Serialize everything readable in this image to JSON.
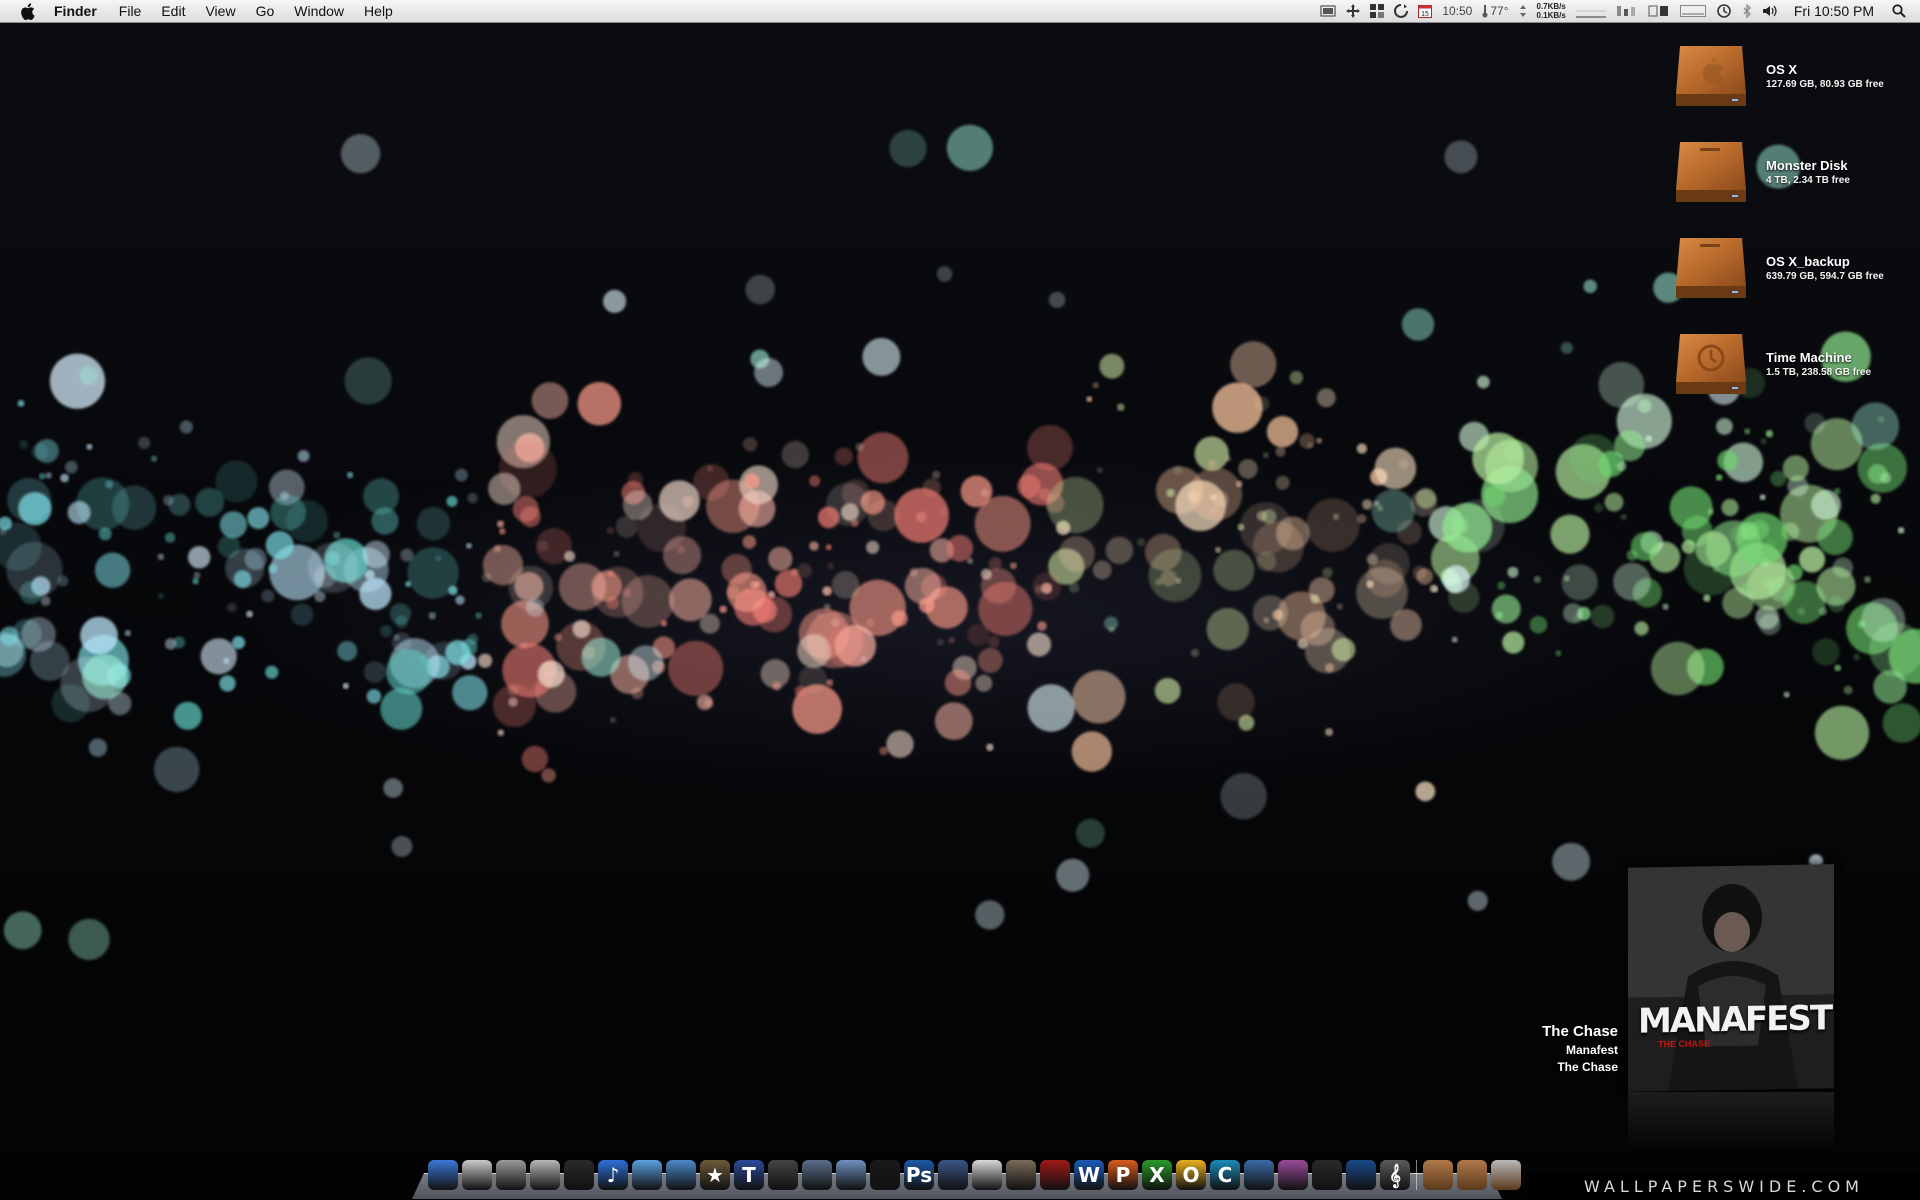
{
  "menubar": {
    "app_name": "Finder",
    "menus": [
      "File",
      "Edit",
      "View",
      "Go",
      "Window",
      "Help"
    ],
    "status": {
      "cal_day": "15",
      "time_short": "10:50",
      "temperature": "77°",
      "net_up": "0.7KB/s",
      "net_down": "0.1KB/s",
      "clock": "Fri 10:50 PM"
    }
  },
  "disks": [
    {
      "name": "OS X",
      "info": "127.69 GB, 80.93 GB free",
      "icon": "apple-logo"
    },
    {
      "name": "Monster Disk",
      "info": "4 TB, 2.34 TB free",
      "icon": "plain"
    },
    {
      "name": "OS X_backup",
      "info": "639.79 GB, 594.7 GB free",
      "icon": "plain"
    },
    {
      "name": "Time Machine",
      "info": "1.5 TB, 238.58 GB free",
      "icon": "time-machine"
    }
  ],
  "now_playing": {
    "title": "The Chase",
    "artist": "Manafest",
    "album": "The Chase",
    "cover_band": "MANAFEST",
    "cover_sub": "THE CHASE"
  },
  "dock": {
    "items": [
      {
        "name": "finder",
        "color": "#3a78d8",
        "glyph": ""
      },
      {
        "name": "preview",
        "color": "#c9c9c9",
        "glyph": ""
      },
      {
        "name": "system-preferences",
        "color": "#9a9a9a",
        "glyph": ""
      },
      {
        "name": "disk-utility",
        "color": "#b8b8b8",
        "glyph": ""
      },
      {
        "name": "activity-monitor",
        "color": "#2a2a2a",
        "glyph": ""
      },
      {
        "name": "itunes",
        "color": "#2f6fd8",
        "glyph": "♪"
      },
      {
        "name": "safari",
        "color": "#5aa0e0",
        "glyph": ""
      },
      {
        "name": "mail",
        "color": "#4a88c8",
        "glyph": ""
      },
      {
        "name": "imovie",
        "color": "#6b5a3a",
        "glyph": "★"
      },
      {
        "name": "textedit",
        "color": "#2c4a9a",
        "glyph": "T"
      },
      {
        "name": "final-cut",
        "color": "#444",
        "glyph": ""
      },
      {
        "name": "iphoto",
        "color": "#5a6e8a",
        "glyph": ""
      },
      {
        "name": "xcode",
        "color": "#6f8fc0",
        "glyph": ""
      },
      {
        "name": "aperture",
        "color": "#1a1a1a",
        "glyph": ""
      },
      {
        "name": "photoshop",
        "color": "#1d5aa8",
        "glyph": "Ps"
      },
      {
        "name": "illustrator",
        "color": "#3a5588",
        "glyph": ""
      },
      {
        "name": "pages",
        "color": "#d8d8d8",
        "glyph": ""
      },
      {
        "name": "iphoto-library",
        "color": "#7a6a5a",
        "glyph": ""
      },
      {
        "name": "photo-booth",
        "color": "#a01818",
        "glyph": ""
      },
      {
        "name": "word",
        "color": "#1a5ab8",
        "glyph": "W"
      },
      {
        "name": "powerpoint",
        "color": "#d85a1a",
        "glyph": "P"
      },
      {
        "name": "excel",
        "color": "#2a9a2a",
        "glyph": "X"
      },
      {
        "name": "outlook",
        "color": "#e8b020",
        "glyph": "O"
      },
      {
        "name": "communicator",
        "color": "#1a8ab8",
        "glyph": "C"
      },
      {
        "name": "keynote",
        "color": "#3a6aa8",
        "glyph": ""
      },
      {
        "name": "dashboard",
        "color": "#9a4a9a",
        "glyph": ""
      },
      {
        "name": "terminal",
        "color": "#2a2a2a",
        "glyph": ""
      },
      {
        "name": "quicktime",
        "color": "#1a4a8a",
        "glyph": ""
      },
      {
        "name": "script-editor",
        "color": "#5a5a5a",
        "glyph": "𝄞"
      }
    ],
    "stacks": [
      {
        "name": "applications-folder",
        "color": "#b0784a"
      },
      {
        "name": "documents-folder",
        "color": "#b0784a"
      },
      {
        "name": "trash",
        "color": "#b8b8b8"
      }
    ]
  },
  "watermark": "WALLPAPERSWIDE.COM"
}
